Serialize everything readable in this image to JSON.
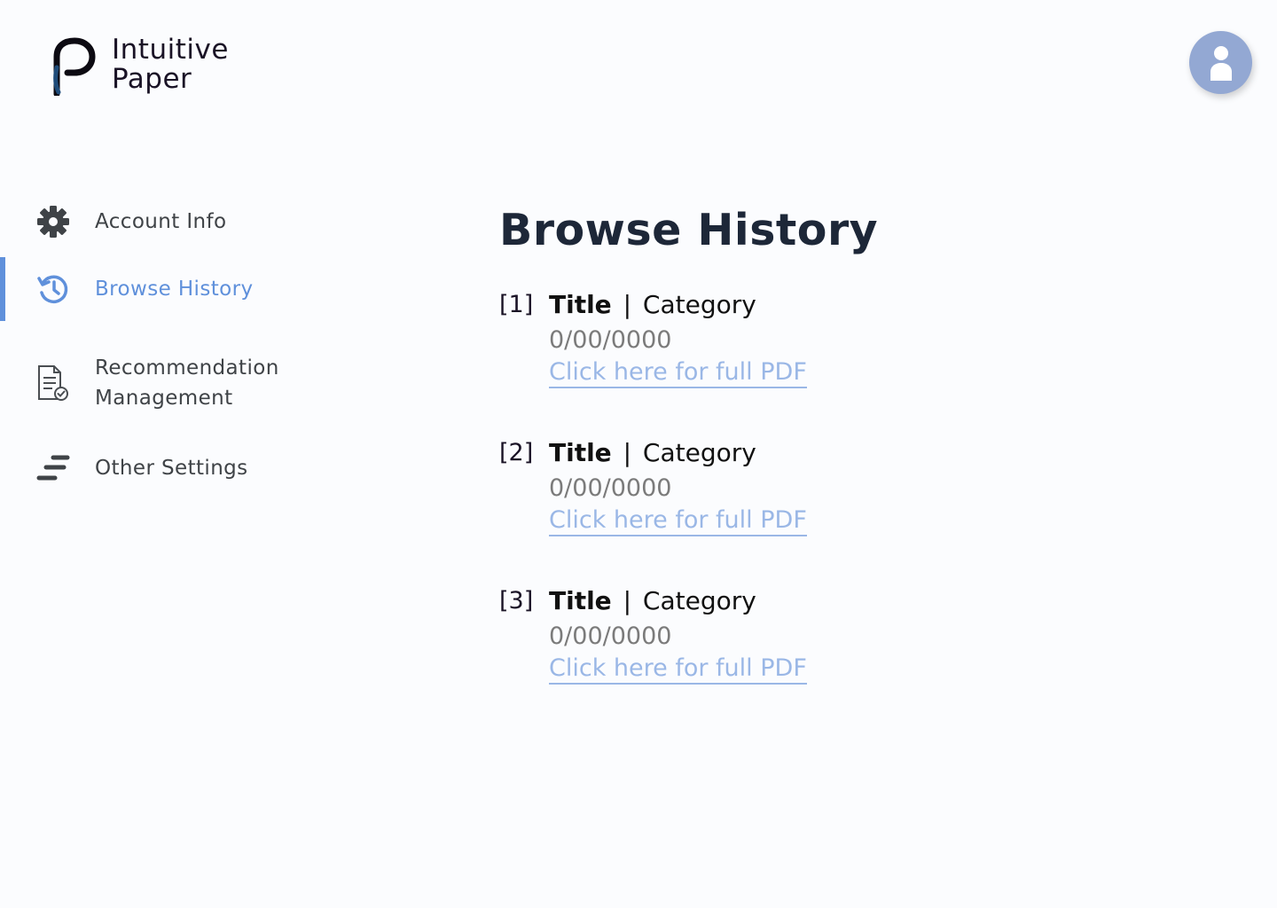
{
  "brand": {
    "line1": "Intuitive",
    "line2": "Paper"
  },
  "avatar": {
    "icon": "user-icon"
  },
  "sidebar": {
    "items": [
      {
        "label": "Account Info",
        "icon": "gear-icon",
        "active": false
      },
      {
        "label": "Browse History",
        "icon": "history-icon",
        "active": true
      },
      {
        "label": "Recommendation Management",
        "icon": "document-check-icon",
        "active": false
      },
      {
        "label": "Other Settings",
        "icon": "bars-icon",
        "active": false
      }
    ]
  },
  "main": {
    "title": "Browse History",
    "items": [
      {
        "index": "[1]",
        "title": "Title",
        "separator": "|",
        "category": "Category",
        "date": "0/00/0000",
        "link": "Click here for full PDF"
      },
      {
        "index": "[2]",
        "title": "Title",
        "separator": "|",
        "category": "Category",
        "date": "0/00/0000",
        "link": "Click here for full PDF"
      },
      {
        "index": "[3]",
        "title": "Title",
        "separator": "|",
        "category": "Category",
        "date": "0/00/0000",
        "link": "Click here for full PDF"
      }
    ]
  },
  "colors": {
    "accent": "#5f90db",
    "link": "#9ab7e6",
    "avatar": "#93a8d3",
    "text_dark": "#1d2738",
    "text_muted": "#7b7b7b"
  }
}
